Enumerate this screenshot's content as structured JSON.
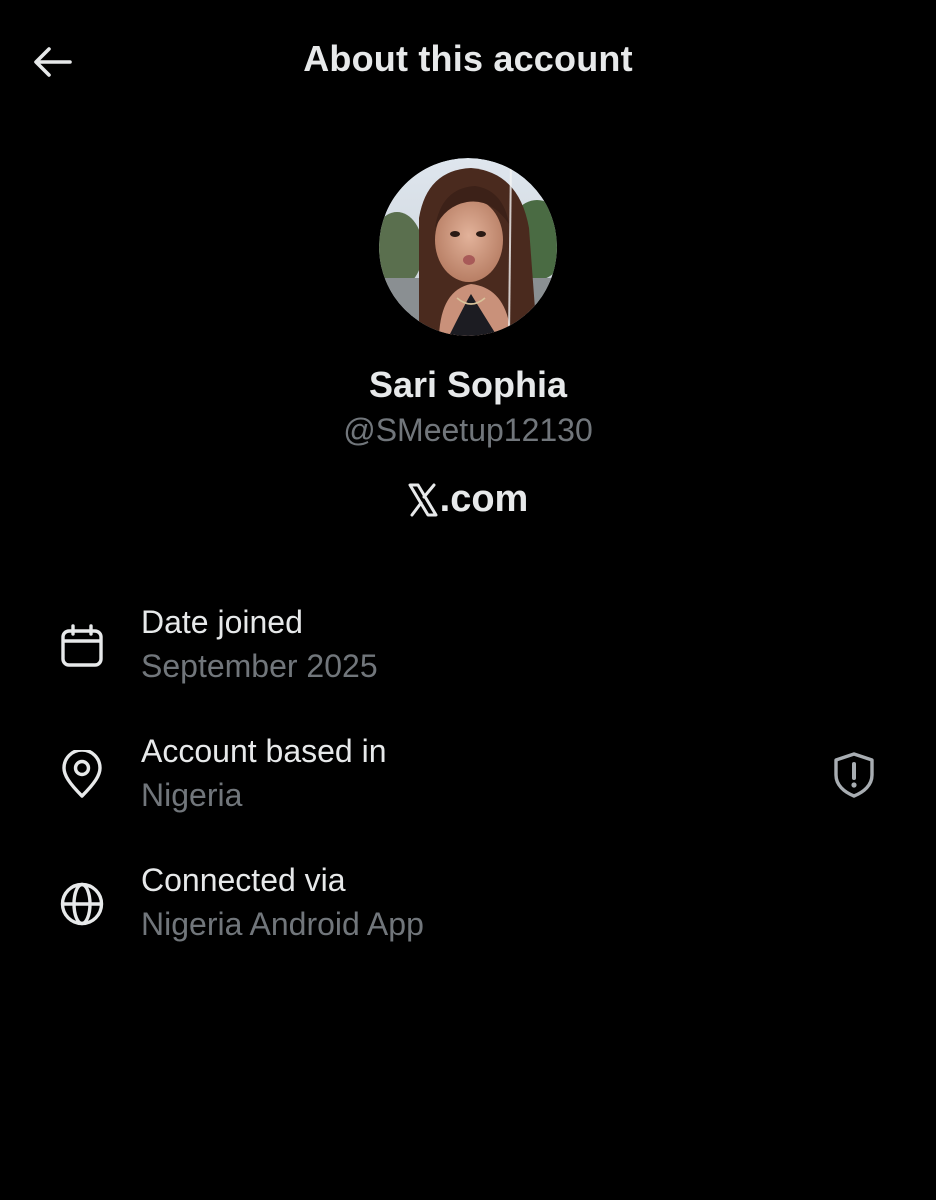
{
  "header": {
    "title": "About this account",
    "back_icon": "arrow-left-icon"
  },
  "profile": {
    "avatar_icon": "profile-photo",
    "display_name": "Sari Sophia",
    "handle": "@SMeetup12130",
    "site_logo_icon": "x-logo-icon",
    "site_suffix": ".com"
  },
  "details": [
    {
      "icon": "calendar-icon",
      "label": "Date joined",
      "value": "September 2025"
    },
    {
      "icon": "location-pin-icon",
      "label": "Account based in",
      "value": "Nigeria",
      "badge_icon": "shield-alert-icon"
    },
    {
      "icon": "globe-icon",
      "label": "Connected via",
      "value": "Nigeria Android App"
    }
  ],
  "colors": {
    "background": "#000000",
    "primary_text": "#e7e9ea",
    "secondary_text": "#71767b",
    "shield": "#a8adb2"
  }
}
